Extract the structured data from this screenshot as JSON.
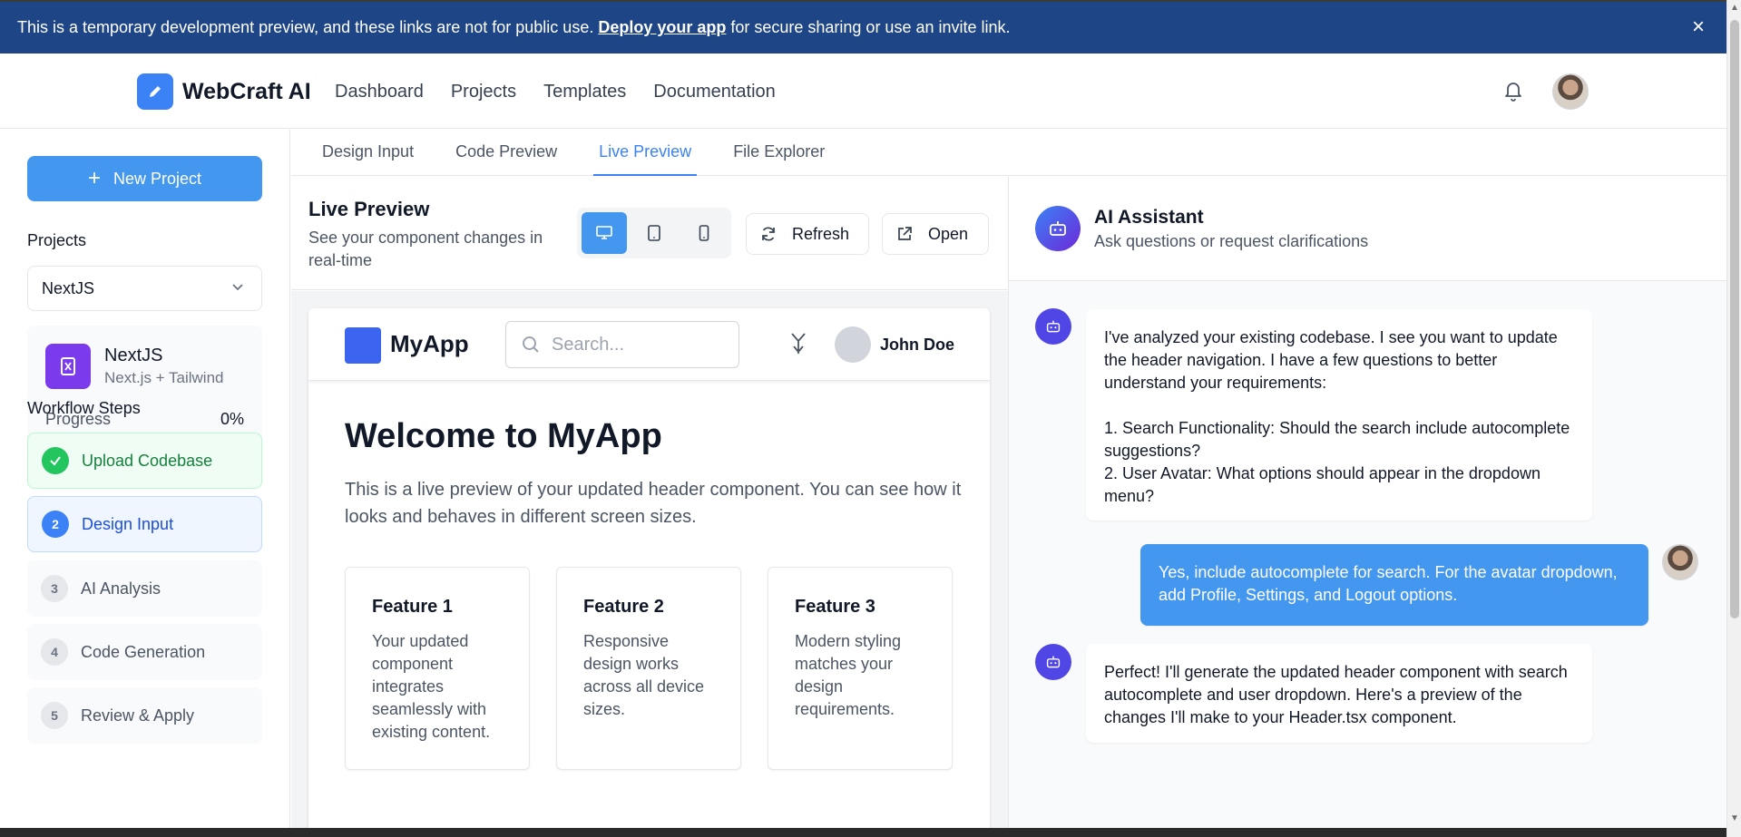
{
  "banner": {
    "text_before": "This is a temporary development preview, and these links are not for public use.",
    "link": "Deploy your app",
    "text_after": "for secure sharing or use an invite link."
  },
  "nav": {
    "brand": "WebCraft AI",
    "links": [
      "Dashboard",
      "Projects",
      "Templates",
      "Documentation"
    ]
  },
  "sidebar": {
    "new_project": "New Project",
    "projects_title": "Projects",
    "selected_project": "NextJS",
    "project_card": {
      "name": "NextJS",
      "subtitle": "Next.js + Tailwind",
      "progress_label": "Progress",
      "progress_text": "0%",
      "progress_value": 0
    },
    "workflow_title": "Workflow Steps",
    "steps": [
      {
        "num": "",
        "label": "Upload Codebase",
        "state": "done"
      },
      {
        "num": "2",
        "label": "Design Input",
        "state": "active"
      },
      {
        "num": "3",
        "label": "AI Analysis",
        "state": "pending"
      },
      {
        "num": "4",
        "label": "Code Generation",
        "state": "pending"
      },
      {
        "num": "5",
        "label": "Review & Apply",
        "state": "pending"
      }
    ]
  },
  "tabs": [
    "Design Input",
    "Code Preview",
    "Live Preview",
    "File Explorer"
  ],
  "live_preview": {
    "title": "Live Preview",
    "subtitle": "See your component changes in real-time",
    "refresh": "Refresh",
    "open": "Open"
  },
  "mock": {
    "brand": "MyApp",
    "search_placeholder": "Search...",
    "user": "John Doe",
    "welcome_title": "Welcome to MyApp",
    "welcome_text": "This is a live preview of your updated header component. You can see how it looks and behaves in different screen sizes.",
    "features": [
      {
        "title": "Feature 1",
        "text": "Your updated component integrates seamlessly with existing content."
      },
      {
        "title": "Feature 2",
        "text": "Responsive design works across all device sizes."
      },
      {
        "title": "Feature 3",
        "text": "Modern styling matches your design requirements."
      }
    ]
  },
  "assistant": {
    "title": "AI Assistant",
    "subtitle": "Ask questions or request clarifications",
    "messages": [
      {
        "from": "ai",
        "text": "I've analyzed your existing codebase. I see you want to update the header navigation. I have a few questions to better understand your requirements:\n\n1. Search Functionality: Should the search include autocomplete suggestions?\n2. User Avatar: What options should appear in the dropdown menu?"
      },
      {
        "from": "user",
        "text": "Yes, include autocomplete for search. For the avatar dropdown, add Profile, Settings, and Logout options."
      },
      {
        "from": "ai",
        "text": "Perfect! I'll generate the updated header component with search autocomplete and user dropdown. Here's a preview of the changes I'll make to your Header.tsx component."
      }
    ]
  },
  "colors": {
    "banner": "#1e4586",
    "accent": "#4497ef",
    "success": "#22c55e",
    "project_icon": "#7c3aed",
    "assistant": "#4f46e5"
  }
}
